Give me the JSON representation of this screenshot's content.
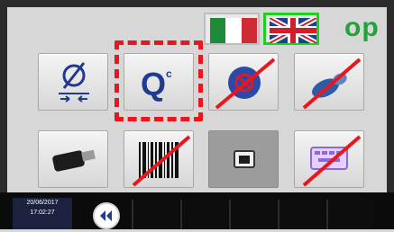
{
  "header": {
    "language_code": "op",
    "flags": [
      {
        "name": "italian-flag",
        "selected": false
      },
      {
        "name": "uk-flag",
        "selected": true
      }
    ]
  },
  "tiles_row1": [
    {
      "name": "diameter-calibration",
      "label": "Ø",
      "disabled": false
    },
    {
      "name": "flow-calibration",
      "label": "Q",
      "superscript": "c",
      "disabled": false,
      "selected": true
    },
    {
      "name": "restricted-function",
      "disabled": true
    },
    {
      "name": "hose-connection",
      "disabled": true
    }
  ],
  "tiles_row2": [
    {
      "name": "usb-drive",
      "disabled": false
    },
    {
      "name": "barcode-scanner",
      "disabled": true
    },
    {
      "name": "network-port",
      "disabled": false
    },
    {
      "name": "keyboard-chat",
      "disabled": true
    }
  ],
  "status": {
    "date": "20/06/2017",
    "time": "17:02:27"
  },
  "colors": {
    "accent": "#1f3a8e",
    "selection": "#e8171d",
    "disabled_strike": "#e8171d",
    "language_green": "#21a33a"
  }
}
